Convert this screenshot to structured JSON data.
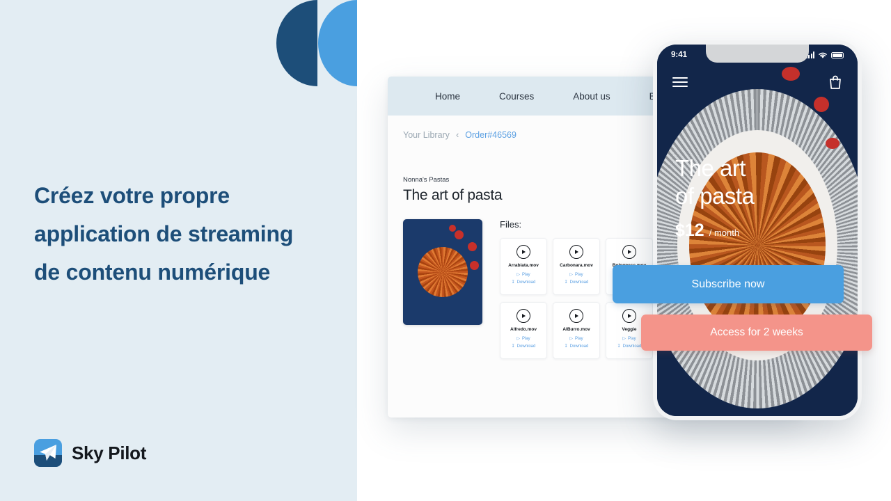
{
  "brand": {
    "name": "Sky Pilot",
    "logo_icon": "paper-plane-icon",
    "colors": {
      "navy": "#1d4e79",
      "blue": "#4a9fe0",
      "salmon": "#f4948a",
      "panel": "#e3edf3"
    }
  },
  "hero": {
    "headline": "Créez votre propre application de streaming de contenu numérique"
  },
  "browser": {
    "nav": [
      {
        "label": "Home"
      },
      {
        "label": "Courses"
      },
      {
        "label": "About us"
      },
      {
        "label": "Books"
      }
    ],
    "breadcrumb": {
      "parent": "Your Library",
      "separator": "‹",
      "current": "Order#46569"
    },
    "content": {
      "kicker": "Nonna's Pastas",
      "title": "The art of pasta",
      "thumbnail_alt": "pasta-bowl-thumbnail",
      "files_label": "Files:",
      "play_label": "Play",
      "download_label": "Download",
      "files": [
        {
          "name": "Arrabiata.mov"
        },
        {
          "name": "Carbonara.mov"
        },
        {
          "name": "Bolognese.mov"
        },
        {
          "name": "Alfredo.mov"
        },
        {
          "name": "AlBurro.mov"
        },
        {
          "name": "Veggie"
        }
      ]
    }
  },
  "phone": {
    "status": {
      "time": "9:41",
      "signal_icon": "signal-bars-icon",
      "wifi_icon": "wifi-icon",
      "battery_icon": "battery-full-icon"
    },
    "topbar": {
      "menu_icon": "hamburger-menu-icon",
      "cart_icon": "shopping-bag-icon"
    },
    "hero": {
      "line1": "The art",
      "line2": "of pasta",
      "price": "$12",
      "period": "/ month"
    },
    "cta": {
      "primary": "Subscribe now",
      "secondary": "Access for 2 weeks"
    }
  }
}
